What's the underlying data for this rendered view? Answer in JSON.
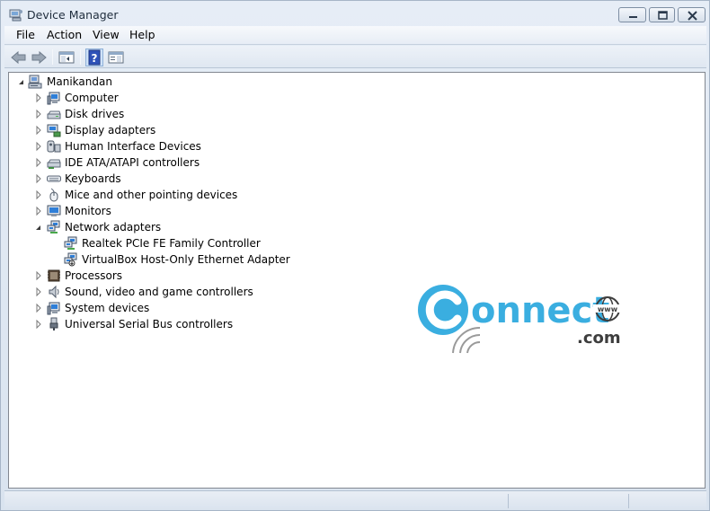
{
  "window": {
    "title": "Device Manager"
  },
  "menu": [
    "File",
    "Action",
    "View",
    "Help"
  ],
  "tree": {
    "root": "Manikandan",
    "items": [
      {
        "label": "Computer",
        "icon": "computer-icon",
        "expanded": false
      },
      {
        "label": "Disk drives",
        "icon": "disk-drive-icon",
        "expanded": false
      },
      {
        "label": "Display adapters",
        "icon": "display-adapter-icon",
        "expanded": false
      },
      {
        "label": "Human Interface Devices",
        "icon": "hid-icon",
        "expanded": false
      },
      {
        "label": "IDE ATA/ATAPI controllers",
        "icon": "ide-controller-icon",
        "expanded": false
      },
      {
        "label": "Keyboards",
        "icon": "keyboard-icon",
        "expanded": false
      },
      {
        "label": "Mice and other pointing devices",
        "icon": "mouse-icon",
        "expanded": false
      },
      {
        "label": "Monitors",
        "icon": "monitor-icon",
        "expanded": false
      },
      {
        "label": "Network adapters",
        "icon": "network-adapter-icon",
        "expanded": true,
        "children": [
          "Realtek PCIe FE Family Controller",
          "VirtualBox Host-Only Ethernet Adapter"
        ]
      },
      {
        "label": "Processors",
        "icon": "processor-icon",
        "expanded": false
      },
      {
        "label": "Sound, video and game controllers",
        "icon": "speaker-icon",
        "expanded": false
      },
      {
        "label": "System devices",
        "icon": "system-device-icon",
        "expanded": false
      },
      {
        "label": "Universal Serial Bus controllers",
        "icon": "usb-icon",
        "expanded": false
      }
    ]
  },
  "watermark": {
    "text_main": "onnect",
    "text_sub": ".com"
  },
  "colors": {
    "accent": "#3aaee0",
    "window_bg": "#dfe6ef",
    "pane_bg": "#ffffff"
  }
}
